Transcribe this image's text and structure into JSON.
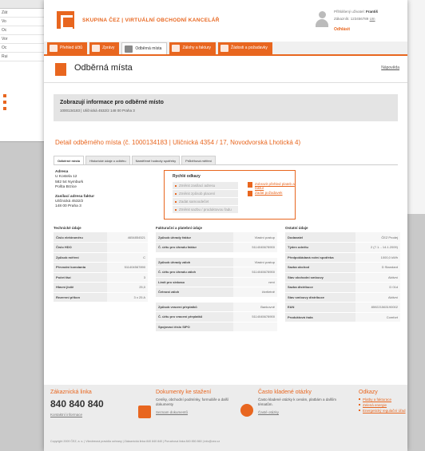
{
  "bg_window_left": {
    "rows": [
      "Zát",
      "Vo",
      "Oc",
      "Vor",
      "Oc",
      "Rui"
    ]
  },
  "header": {
    "brand": "SKUPINA ČEZ | VIRTUÁLNÍ OBCHODNÍ KANCELÁŘ",
    "user_line1": "Přihlášený uživatel:",
    "user_name": "Františ",
    "user_line2": "Zákazník: 123456789",
    "user_line2b": "Um",
    "logout": "Odhlásit"
  },
  "nav": {
    "tabs": [
      "Přehled účtů",
      "Zprávy",
      "Odběrná místa",
      "Zálohy a faktury",
      "Žádosti a požadavky"
    ],
    "active_index": 2
  },
  "page": {
    "title": "Odběrná místa",
    "title_link": "Nápověda",
    "info_heading": "Zobrazují informace pro odběrné místo",
    "info_sub": "1000134183 | Uličnická 4532/2 148 00 Praha 3",
    "detail_title": "Detail odběrného místa (č. 1000134183 | Uličnická 4354 / 17, Novodvorská Lhotická 4)"
  },
  "subtabs": [
    "Odběrné místo",
    "Historické údaje o odběru",
    "Naměřené hodnoty spotřeby",
    "Průběhová měření"
  ],
  "address": {
    "label": "Adresa",
    "lines": [
      "U Kostela 12",
      "582 54 Nymburk",
      "Pošta Brzice"
    ],
    "label2": "Zasílací adresa faktur",
    "lines2": [
      "Uličnická 4532/2",
      "148 00 Praha 3"
    ]
  },
  "quick": {
    "title": "Rychlé odkazy",
    "left": [
      "Změnit zasílací adresu",
      "Změnit způsob placení",
      "Zadat samoodečet",
      "Změnit sazbu / produktovou řadu"
    ],
    "right": [
      "Zobrazit přehled plateb a faktur",
      "Zadat požadavek"
    ]
  },
  "tech": {
    "heading": "Technické údaje",
    "rows": [
      [
        "Číslo elektroměru",
        "4654854521"
      ],
      [
        "Číslo HDO",
        ""
      ],
      [
        "Způsob měření",
        "C"
      ],
      [
        "Převodní konstanta",
        "511404567890"
      ],
      [
        "Počet fází",
        "3"
      ],
      [
        "Hlavní jistič",
        "25,0"
      ],
      [
        "Rezervní příkon",
        "3 x 25 A"
      ]
    ]
  },
  "billing": {
    "heading": "Fakturační a platební údaje",
    "rows": [
      [
        "Způsob úhrady faktur",
        "Vlastní postup"
      ],
      [
        "Č. účtu pro úhradu faktur",
        "5114045678900"
      ],
      [
        "",
        ""
      ],
      [
        "Způsob úhrady záloh",
        "Vlastní postup"
      ],
      [
        "Č. účtu pro úhradu záloh",
        "5114045678900"
      ],
      [
        "Limit pro sinkaso",
        "není"
      ],
      [
        "Četnost záloh",
        "čtvrtletně"
      ],
      [
        "",
        ""
      ],
      [
        "Způsob vracení přeplatků",
        "Bankovně"
      ],
      [
        "Č. účtu pro vracení přeplatků",
        "5114045678900"
      ],
      [
        "Spojovací číslo SIPO",
        ""
      ]
    ]
  },
  "other": {
    "heading": "Ostatní údaje",
    "rows": [
      [
        "Dodavatel",
        "ČEZ Prodej"
      ],
      [
        "Týden odečtu",
        "2 (7.1. - 14.1.2009)"
      ],
      [
        "Předpokládaná roční spotřeba",
        "1000,0 kWh"
      ],
      [
        "Sazba obchod",
        "D Standard"
      ],
      [
        "Stav obchodní smlouvy",
        "Aktivní"
      ],
      [
        "Sazba distribuce",
        "D 01d"
      ],
      [
        "Stav smlouvy distribuce",
        "Aktivní"
      ],
      [
        "EAN",
        "859221563190002"
      ],
      [
        "Produktová řada",
        "Comfort"
      ]
    ]
  },
  "footer": {
    "c1_head": "Zákaznická linka",
    "c1_phone": "840 840 840",
    "c1_link": "Kontaktní informace",
    "c2_head": "Dokumenty ke stažení",
    "c2_body": "Ceníky, obchodní podmínky, formuláře a další dokumenty",
    "c2_link": "Seznam dokumentů",
    "c3_head": "Často kladené otázky",
    "c3_body": "Často kladené otázky k cenám, platbám a dalším tématům.",
    "c3_link": "Časté otázky",
    "c4_head": "Odkazy",
    "c4_links": [
      "Platby a fakturace",
      "Zelená energie",
      "Energetický regulační úřad"
    ],
    "copyright": "Copyright 2009 ČEZ, a. s.  |  Všeobecná pravidla ochrany  |  Zákaznická linka 840 840 840  |  Poruchová linka 840 850 860  |  info@cez.cz"
  },
  "colors": {
    "accent": "#e8661f",
    "grey": "#ececec"
  }
}
